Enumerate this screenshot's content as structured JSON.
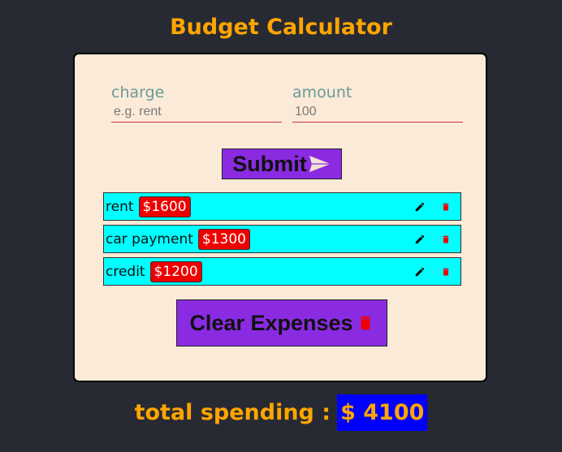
{
  "app": {
    "title": "Budget Calculator"
  },
  "form": {
    "charge": {
      "label": "charge",
      "placeholder": "e.g. rent",
      "value": ""
    },
    "amount": {
      "label": "amount",
      "placeholder": "100",
      "value": ""
    },
    "submit_label": "Submit"
  },
  "expenses": [
    {
      "name": "rent",
      "amount": "$1600"
    },
    {
      "name": "car payment",
      "amount": "$1300"
    },
    {
      "name": "credit",
      "amount": "$1200"
    }
  ],
  "clear_label": "Clear Expenses",
  "total": {
    "label": "total spending :",
    "value": "$ 4100"
  },
  "icons": {
    "submit": "send-icon",
    "edit": "pencil-icon",
    "delete": "trash-icon",
    "clear": "trash-icon"
  },
  "colors": {
    "background": "#272a33",
    "title": "#ffa500",
    "card": "#fbead7",
    "button": "#8a2be2",
    "row": "#00ffff",
    "amount_badge": "#ee0000",
    "delete_icon": "#ee0000",
    "total_badge": "#0000ff"
  }
}
